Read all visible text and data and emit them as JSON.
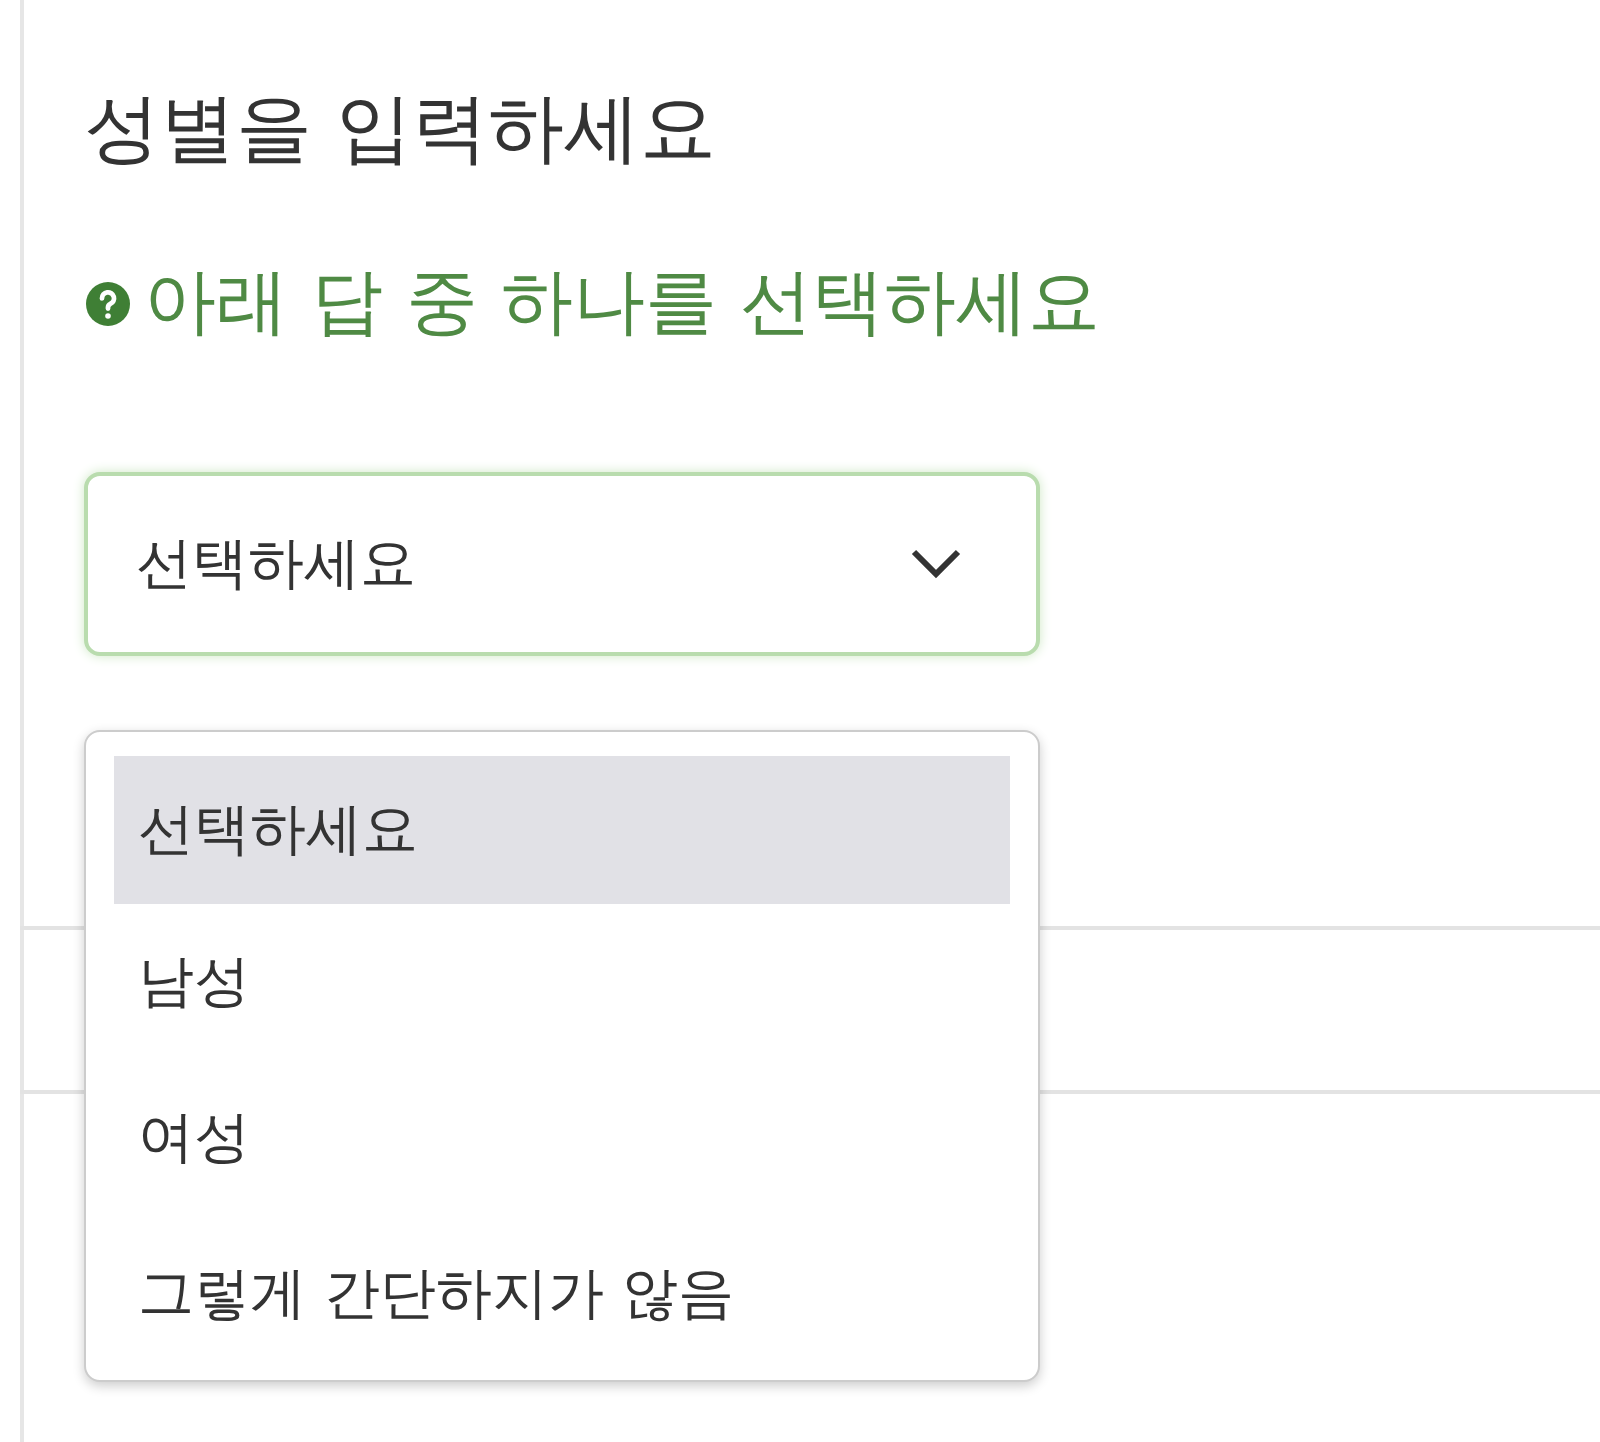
{
  "title": "성별을 입력하세요",
  "help_text": "아래 답 중 하나를 선택하세요",
  "select": {
    "value": "선택하세요",
    "expanded": true,
    "options": [
      {
        "label": "선택하세요",
        "selected": true
      },
      {
        "label": "남성",
        "selected": false
      },
      {
        "label": "여성",
        "selected": false
      },
      {
        "label": "그렇게 간단하지가 않음",
        "selected": false
      }
    ]
  }
}
